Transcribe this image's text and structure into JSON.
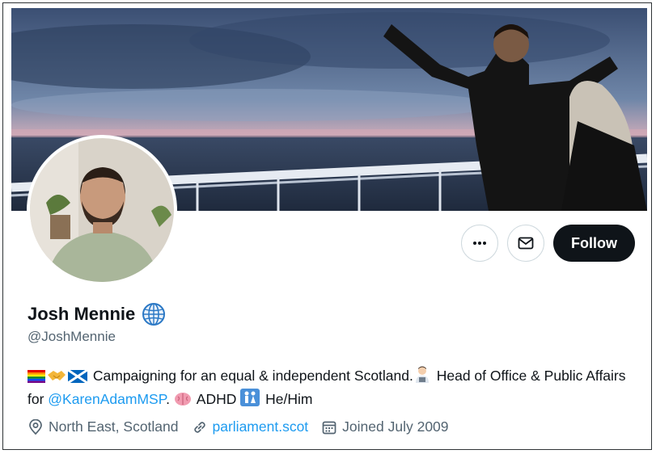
{
  "profile": {
    "name": "Josh Mennie",
    "handle": "@JoshMennie",
    "verified_badge_icon": "globe-icon"
  },
  "actions": {
    "more_icon": "more-icon",
    "message_icon": "mail-icon",
    "follow_label": "Follow"
  },
  "bio": {
    "part1": "Campaigning for an equal & independent Scotland.",
    "part2": " Head of Office & Public Affairs for ",
    "mention": "@KarenAdamMSP",
    "part3": ". ",
    "part4": " ADHD ",
    "part5": " He/Him",
    "emoji": [
      "rainbow-flag-emoji",
      "handshake-emoji",
      "scotland-flag-emoji",
      "office-worker-emoji",
      "brain-emoji",
      "family-emoji"
    ]
  },
  "meta": {
    "location": "North East, Scotland",
    "website": "parliament.scot",
    "joined": "Joined July 2009"
  },
  "colors": {
    "accent": "#1d9bf0",
    "text": "#0f1419",
    "secondary": "#536471"
  }
}
